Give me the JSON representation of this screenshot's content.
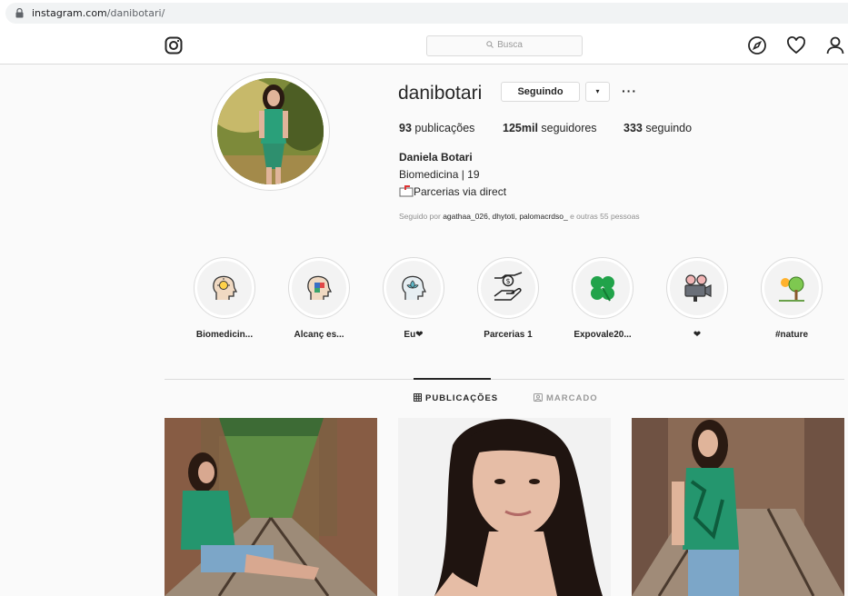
{
  "browser": {
    "url_host": "instagram.com",
    "url_path": "/danibotari/"
  },
  "header": {
    "search_placeholder": "Busca"
  },
  "profile": {
    "username": "danibotari",
    "follow_button": "Seguindo",
    "dropdown": "▾",
    "more": "···",
    "stats": {
      "posts_count": "93",
      "posts_label": "publicações",
      "followers_count": "125mil",
      "followers_label": "seguidores",
      "following_count": "333",
      "following_label": "seguindo"
    },
    "full_name": "Daniela Botari",
    "bio_line1": "Biomedicina | 19",
    "bio_line2": "Parcerias via direct",
    "followed_prefix": "Seguido por ",
    "followed_users": "agathaa_026, dhytoti, palomacrdso_",
    "followed_suffix": " e outras 55 pessoas"
  },
  "highlights": [
    {
      "label": "Biomedicin...",
      "icon": "head-idea-icon"
    },
    {
      "label": "Alcanç es...",
      "icon": "head-puzzle-icon"
    },
    {
      "label": "Eu❤",
      "icon": "head-lotus-icon"
    },
    {
      "label": "Parcerias 1",
      "icon": "money-hand-icon"
    },
    {
      "label": "Expovale20...",
      "icon": "clover-icon"
    },
    {
      "label": "❤",
      "icon": "movie-camera-icon"
    },
    {
      "label": "#nature",
      "icon": "sun-tree-icon"
    }
  ],
  "tabs": {
    "posts": "PUBLICAÇÕES",
    "tagged": "MARCADO"
  },
  "colors": {
    "border": "#dbdbdb",
    "text": "#262626",
    "muted": "#8e8e8e",
    "bg": "#fafafa"
  }
}
